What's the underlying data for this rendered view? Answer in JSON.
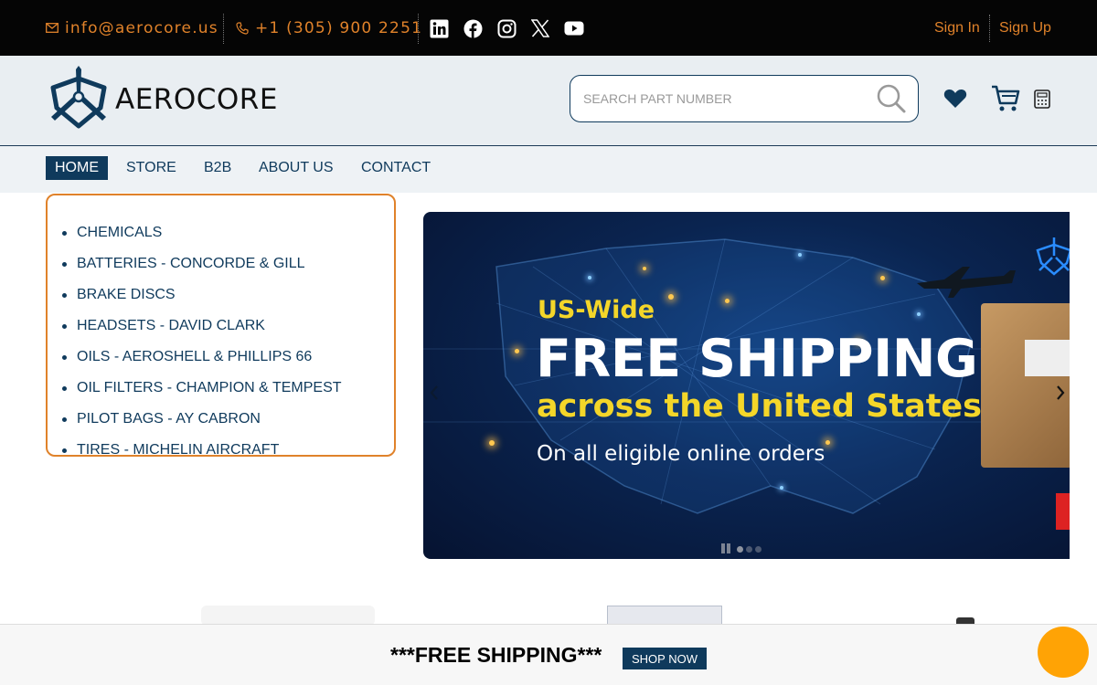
{
  "topbar": {
    "email": "info@aerocore.us",
    "phone": "+1 (305) 900 2251",
    "social": [
      "linkedin-icon",
      "facebook-icon",
      "instagram-icon",
      "x-icon",
      "youtube-icon"
    ],
    "sign_in": "Sign In",
    "sign_up": "Sign Up",
    "accent_color": "#e0822a"
  },
  "header": {
    "logo_text": "AEROCORE",
    "search_placeholder": "SEARCH PART NUMBER",
    "icons": [
      "heart-icon",
      "cart-icon",
      "calculator-icon"
    ]
  },
  "nav": {
    "items": [
      "HOME",
      "STORE",
      "B2B",
      "ABOUT US",
      "CONTACT"
    ],
    "active": "HOME"
  },
  "categories": [
    "CHEMICALS",
    "BATTERIES - CONCORDE & GILL",
    "BRAKE DISCS",
    "HEADSETS - DAVID CLARK",
    "OILS - AEROSHELL & PHILLIPS 66",
    "OIL FILTERS - CHAMPION & TEMPEST",
    "PILOT BAGS - AY CABRON",
    "TIRES - MICHELIN AIRCRAFT"
  ],
  "banner": {
    "line1": "US-Wide",
    "line2": "FREE SHIPPING",
    "line3": "across the United States",
    "line4": "On all eligible online orders"
  },
  "promo": {
    "text": "***FREE SHIPPING***",
    "button": "SHOP NOW"
  },
  "colors": {
    "primary": "#0f3a5c",
    "accent": "#e0822a",
    "chat": "#ffa305"
  }
}
